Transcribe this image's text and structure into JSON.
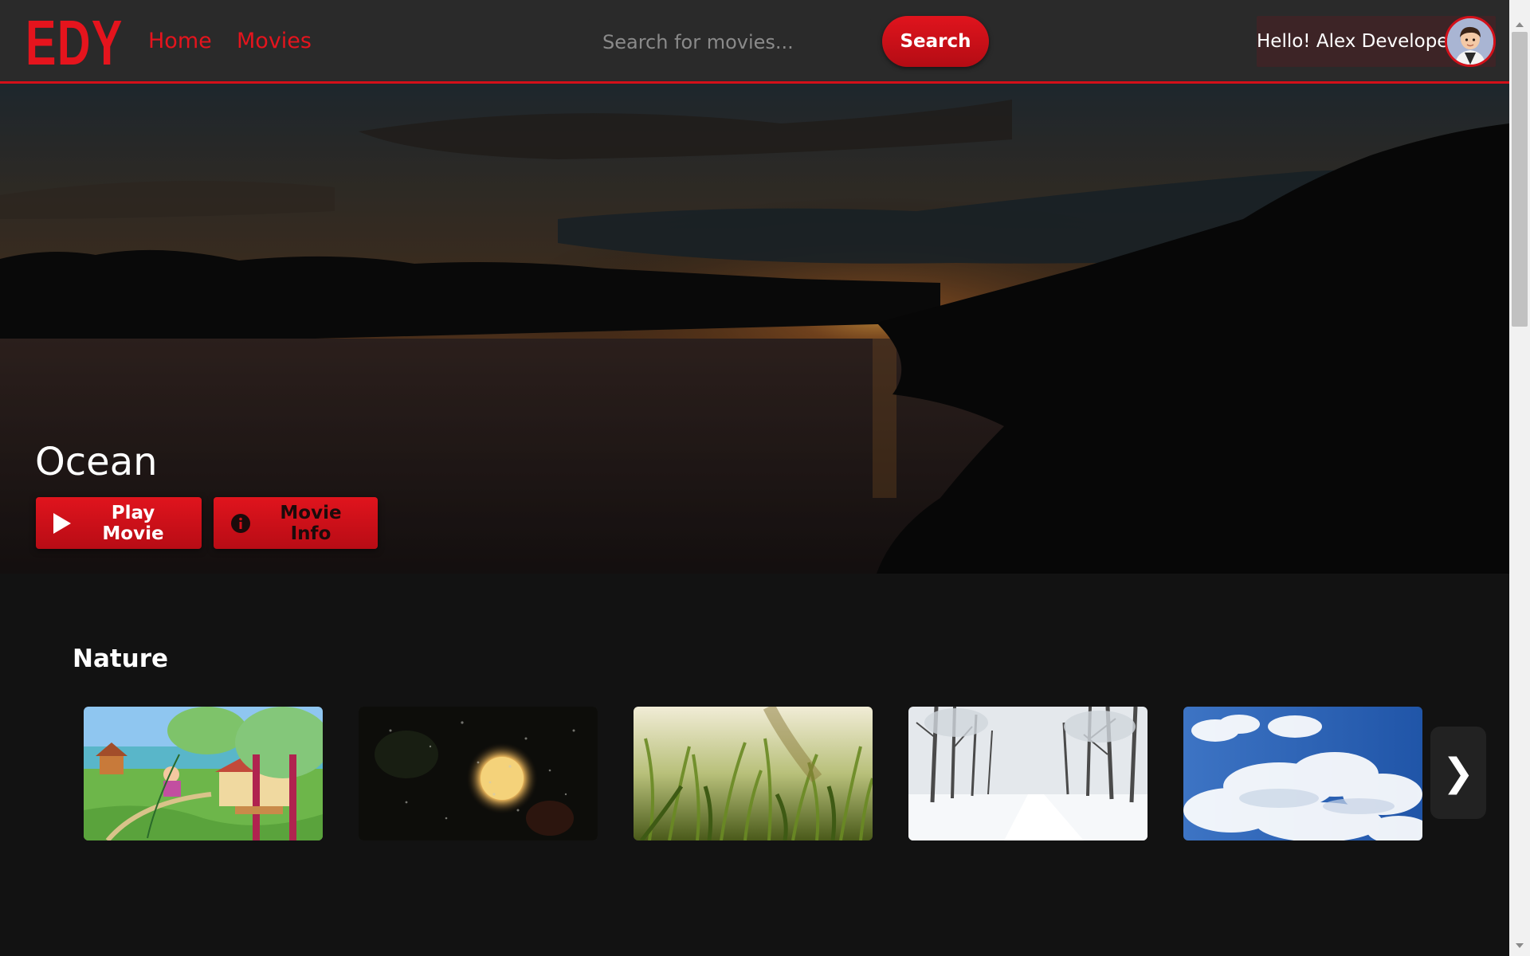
{
  "header": {
    "logo": "EDY",
    "nav": [
      {
        "label": "Home"
      },
      {
        "label": "Movies"
      }
    ],
    "search": {
      "placeholder": "Search for movies...",
      "value": "",
      "button_label": "Search"
    },
    "user": {
      "greeting": "Hello! Alex Developer"
    }
  },
  "hero": {
    "title": "Ocean",
    "play_label": "Play Movie",
    "info_label": "Movie Info",
    "play_icon": "play-icon",
    "info_icon": "info-icon"
  },
  "rows": [
    {
      "title": "Nature",
      "thumbnails": [
        {
          "name": "cartoon-park-scene"
        },
        {
          "name": "rainy-window-moon"
        },
        {
          "name": "green-grass-closeup"
        },
        {
          "name": "snowy-forest-path"
        },
        {
          "name": "blue-sky-clouds"
        }
      ],
      "next_icon": "chevron-right-icon",
      "next_label": "❯"
    }
  ],
  "colors": {
    "accent": "#e5141d",
    "header_bg": "#2a2a2a",
    "page_bg": "#121212",
    "user_box_bg": "#3d2426"
  }
}
